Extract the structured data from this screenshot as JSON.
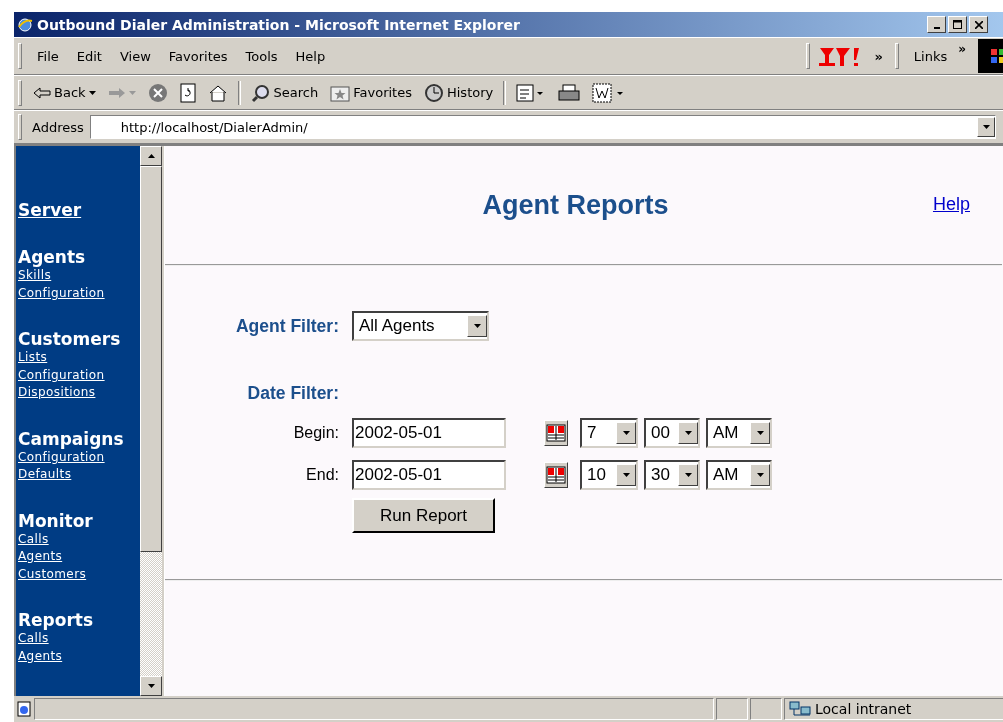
{
  "window": {
    "title": "Outbound Dialer Administration - Microsoft Internet Explorer"
  },
  "menu": [
    "File",
    "Edit",
    "View",
    "Favorites",
    "Tools",
    "Help"
  ],
  "menu_extras": {
    "chevron": "»",
    "links": "Links",
    "links_chevron": "»"
  },
  "toolbar": [
    {
      "kind": "back",
      "label": "Back"
    },
    {
      "kind": "forward"
    },
    {
      "kind": "stop"
    },
    {
      "kind": "refresh"
    },
    {
      "kind": "home"
    },
    {
      "kind": "search",
      "label": "Search"
    },
    {
      "kind": "favorites",
      "label": "Favorites"
    },
    {
      "kind": "history",
      "label": "History"
    },
    {
      "kind": "mail"
    },
    {
      "kind": "print"
    },
    {
      "kind": "edit"
    }
  ],
  "address": {
    "label": "Address",
    "url": "http://localhost/DialerAdmin/"
  },
  "sidebar": [
    {
      "heading": "Server",
      "kind": "link"
    },
    {
      "heading": "Agents",
      "kind": "heading",
      "links": [
        "Skills",
        "Configuration"
      ]
    },
    {
      "heading": "Customers",
      "kind": "heading",
      "links": [
        "Lists",
        "Configuration",
        "Dispositions"
      ]
    },
    {
      "heading": "Campaigns",
      "kind": "heading",
      "links": [
        "Configuration",
        "Defaults"
      ]
    },
    {
      "heading": "Monitor",
      "kind": "heading",
      "links": [
        "Calls",
        "Agents",
        "Customers"
      ]
    },
    {
      "heading": "Reports",
      "kind": "heading",
      "links": [
        "Calls",
        "Agents"
      ]
    }
  ],
  "page": {
    "title": "Agent Reports",
    "help": "Help",
    "agent_filter": {
      "label": "Agent Filter:",
      "value": "All Agents"
    },
    "date_filter": {
      "label": "Date Filter:",
      "rows": [
        {
          "label": "Begin:",
          "date": "2002-05-01",
          "hour": "7",
          "minute": "00",
          "ampm": "AM"
        },
        {
          "label": "End:",
          "date": "2002-05-01",
          "hour": "10",
          "minute": "30",
          "ampm": "AM"
        }
      ]
    },
    "button": "Run Report"
  },
  "status_bar": {
    "zone": "Local intranet"
  }
}
